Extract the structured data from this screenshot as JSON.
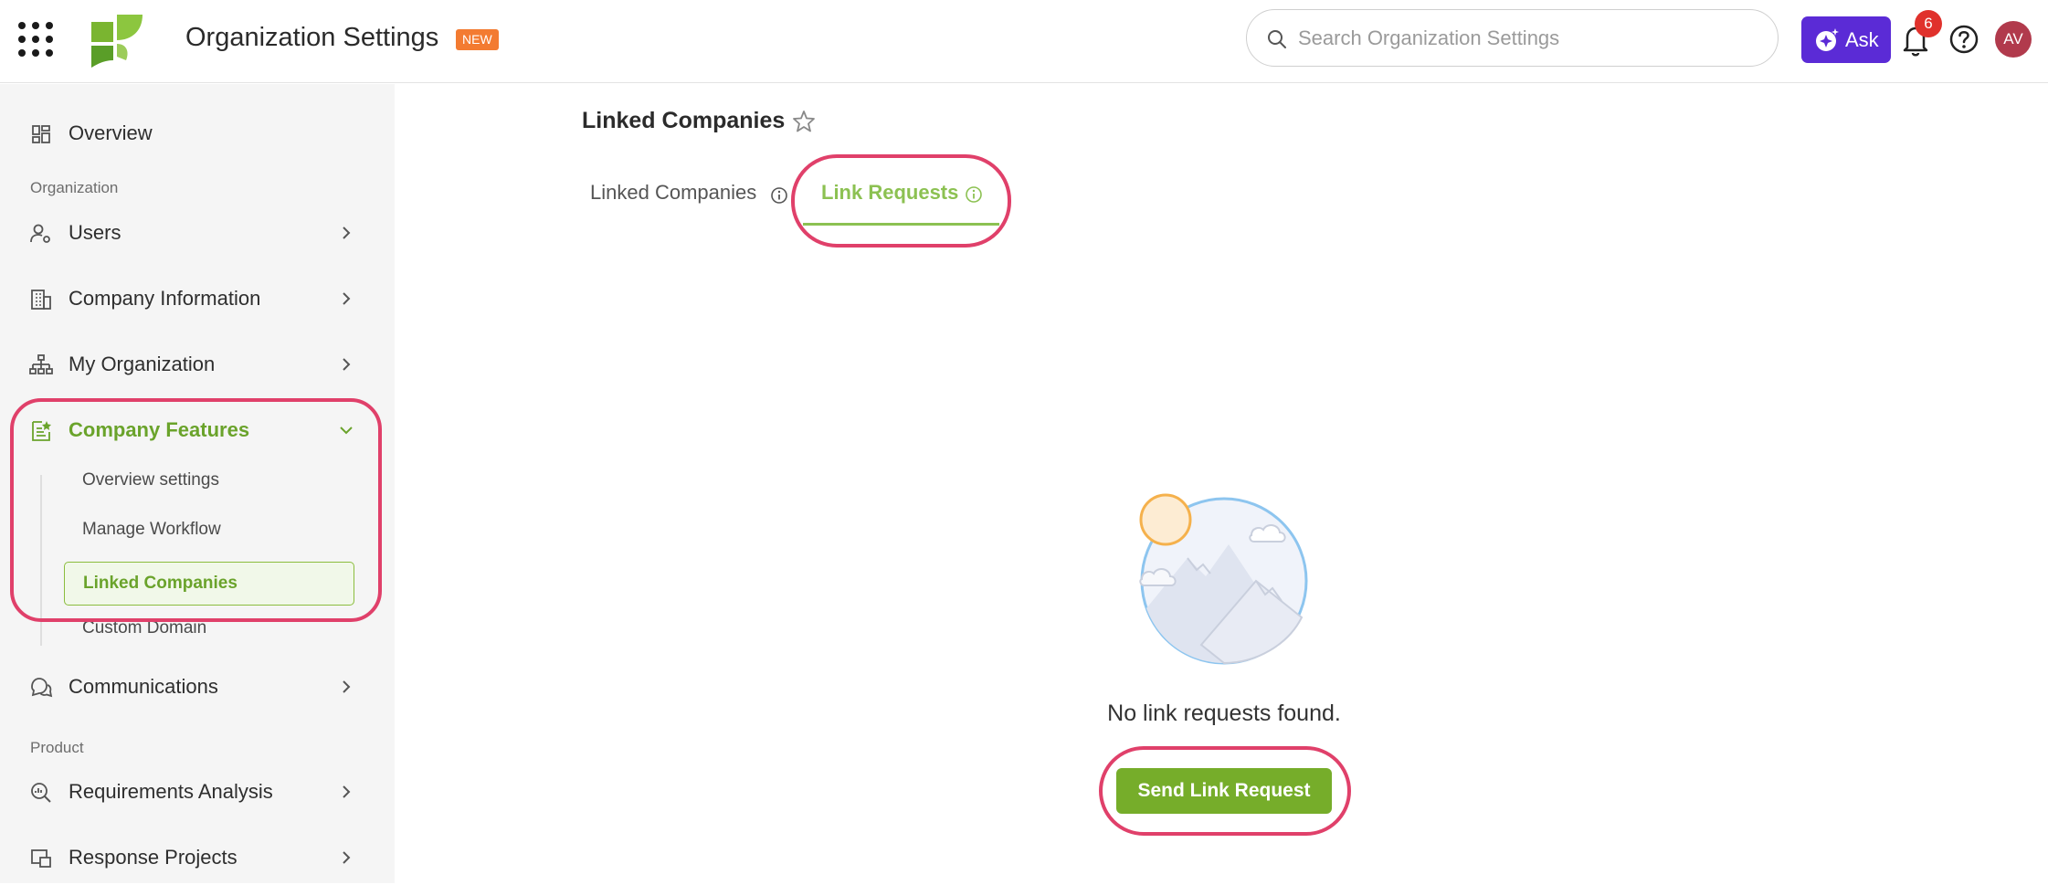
{
  "header": {
    "app_title": "Organization Settings",
    "new_badge": "NEW",
    "search_placeholder": "Search Organization Settings",
    "ask_label": "Ask",
    "notification_count": "6",
    "avatar_initials": "AV"
  },
  "sidebar": {
    "overview": "Overview",
    "section_organization": "Organization",
    "users": "Users",
    "company_information": "Company Information",
    "my_organization": "My Organization",
    "company_features": "Company Features",
    "sub_items": [
      "Overview settings",
      "Manage Workflow",
      "Linked Companies",
      "Custom Domain"
    ],
    "communications": "Communications",
    "section_product": "Product",
    "requirements_analysis": "Requirements Analysis",
    "response_projects": "Response Projects"
  },
  "main": {
    "page_title": "Linked Companies",
    "tabs": [
      {
        "label": "Linked Companies"
      },
      {
        "label": "Link Requests"
      }
    ],
    "empty_message": "No link requests found.",
    "send_button": "Send Link Request"
  },
  "colors": {
    "accent_green": "#8cc152",
    "button_green": "#76ad2a",
    "ask_purple": "#5b2bd6",
    "annotation_pink": "#e0406a",
    "new_badge_orange": "#f37b31"
  }
}
